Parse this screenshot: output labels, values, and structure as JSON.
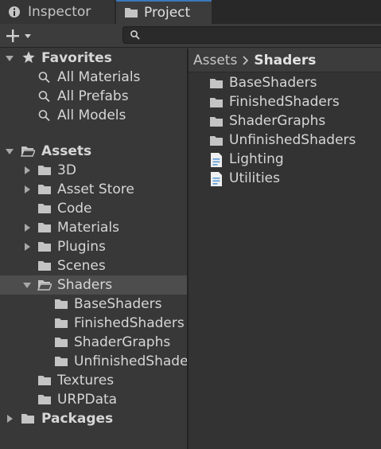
{
  "tabs": [
    {
      "label": "Inspector",
      "icon": "info-icon"
    },
    {
      "label": "Project",
      "icon": "folder-icon",
      "active": true
    }
  ],
  "toolbar": {
    "create_icon": "plus-icon",
    "search_placeholder": ""
  },
  "colors": {
    "accent": "#3a79bb",
    "folder": "#c2c2c2",
    "selected": "#4d4d4d",
    "script_icon": "#5b9bd5"
  },
  "tree": {
    "favorites": {
      "label": "Favorites",
      "items": [
        "All Materials",
        "All Prefabs",
        "All Models"
      ]
    },
    "assets": {
      "label": "Assets",
      "items": [
        "3D",
        "Asset Store",
        "Code",
        "Materials",
        "Plugins",
        "Scenes",
        "Shaders",
        "Textures",
        "URPData"
      ]
    },
    "shaders_children": [
      "BaseShaders",
      "FinishedShaders",
      "ShaderGraphs",
      "UnfinishedShaders"
    ],
    "packages": {
      "label": "Packages"
    }
  },
  "breadcrumb": {
    "root": "Assets",
    "current": "Shaders"
  },
  "contents": [
    {
      "label": "BaseShaders",
      "type": "folder"
    },
    {
      "label": "FinishedShaders",
      "type": "folder"
    },
    {
      "label": "ShaderGraphs",
      "type": "folder"
    },
    {
      "label": "UnfinishedShaders",
      "type": "folder"
    },
    {
      "label": "Lighting",
      "type": "shader-file"
    },
    {
      "label": "Utilities",
      "type": "shader-file"
    }
  ]
}
